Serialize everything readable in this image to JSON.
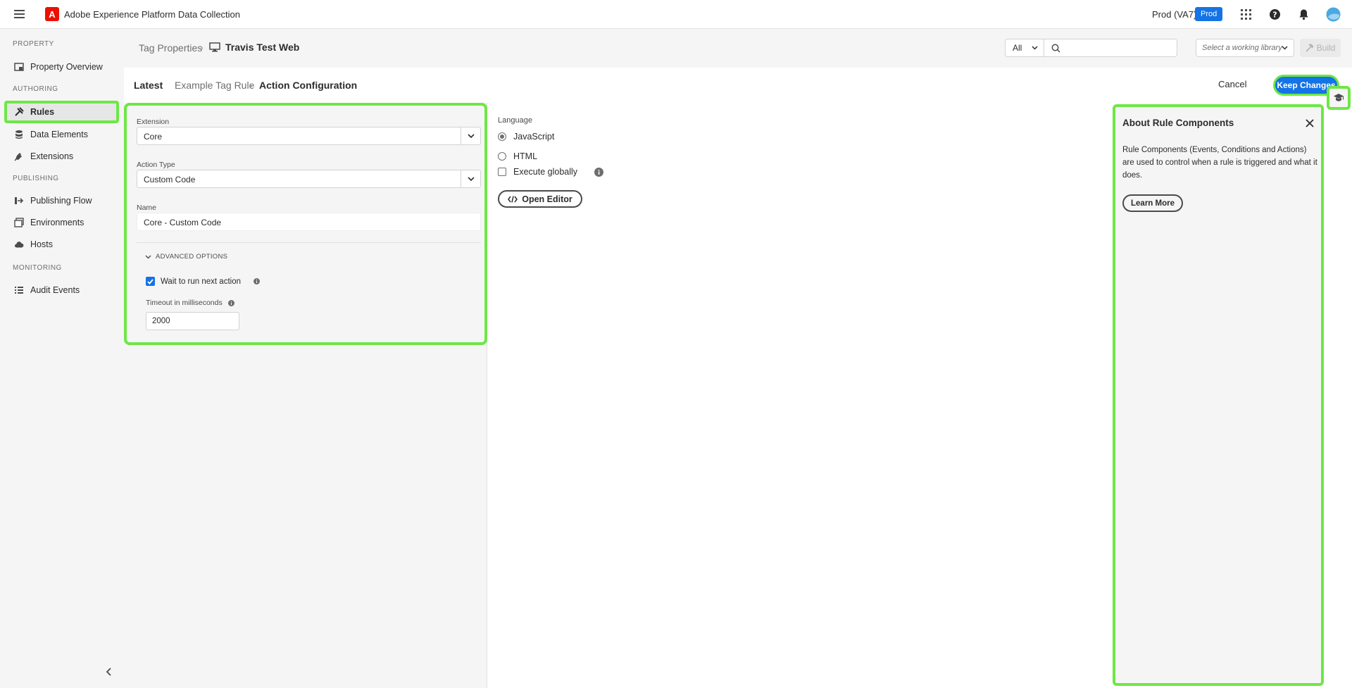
{
  "app": {
    "title": "Adobe Experience Platform Data Collection",
    "logo_letter": "A",
    "org": "Prod (VA7)",
    "env_badge": "Prod"
  },
  "sidebar": {
    "sections": {
      "property": "PROPERTY",
      "authoring": "AUTHORING",
      "publishing": "PUBLISHING",
      "monitoring": "MONITORING"
    },
    "items": [
      {
        "label": "Property Overview",
        "icon": "property-overview-icon"
      },
      {
        "label": "Rules",
        "icon": "rules-icon"
      },
      {
        "label": "Data Elements",
        "icon": "data-elements-icon"
      },
      {
        "label": "Extensions",
        "icon": "extensions-icon"
      },
      {
        "label": "Publishing Flow",
        "icon": "publishing-flow-icon"
      },
      {
        "label": "Environments",
        "icon": "environments-icon"
      },
      {
        "label": "Hosts",
        "icon": "hosts-icon"
      },
      {
        "label": "Audit Events",
        "icon": "audit-events-icon"
      }
    ],
    "active": "Rules"
  },
  "crumbs": {
    "parent": "Tag Properties",
    "current": "Travis Test Web"
  },
  "filter": {
    "value": "All"
  },
  "search": {
    "placeholder": ""
  },
  "library": {
    "placeholder": "Select a working library"
  },
  "build": {
    "label": "Build"
  },
  "page": {
    "latest": "Latest",
    "rule": "Example Tag Rule",
    "current": "Action Configuration",
    "cancel": "Cancel",
    "keep": "Keep Changes"
  },
  "config": {
    "extension_label": "Extension",
    "extension_value": "Core",
    "action_type_label": "Action Type",
    "action_type_value": "Custom Code",
    "name_label": "Name",
    "name_value": "Core - Custom Code",
    "advanced_label": "ADVANCED OPTIONS",
    "wait_label": "Wait to run next action",
    "wait_checked": true,
    "timeout_label": "Timeout in milliseconds",
    "timeout_value": "2000"
  },
  "code": {
    "language_label": "Language",
    "options": [
      "JavaScript",
      "HTML"
    ],
    "selected": "JavaScript",
    "execute_label": "Execute globally",
    "open_editor": "Open Editor"
  },
  "about": {
    "title": "About Rule Components",
    "text": "Rule Components (Events, Conditions and Actions) are used to control when a rule is triggered and what it does.",
    "learn_more": "Learn More"
  },
  "colors": {
    "accent": "#1473e6",
    "highlight": "#6ee745",
    "adobe_red": "#eb1000"
  }
}
